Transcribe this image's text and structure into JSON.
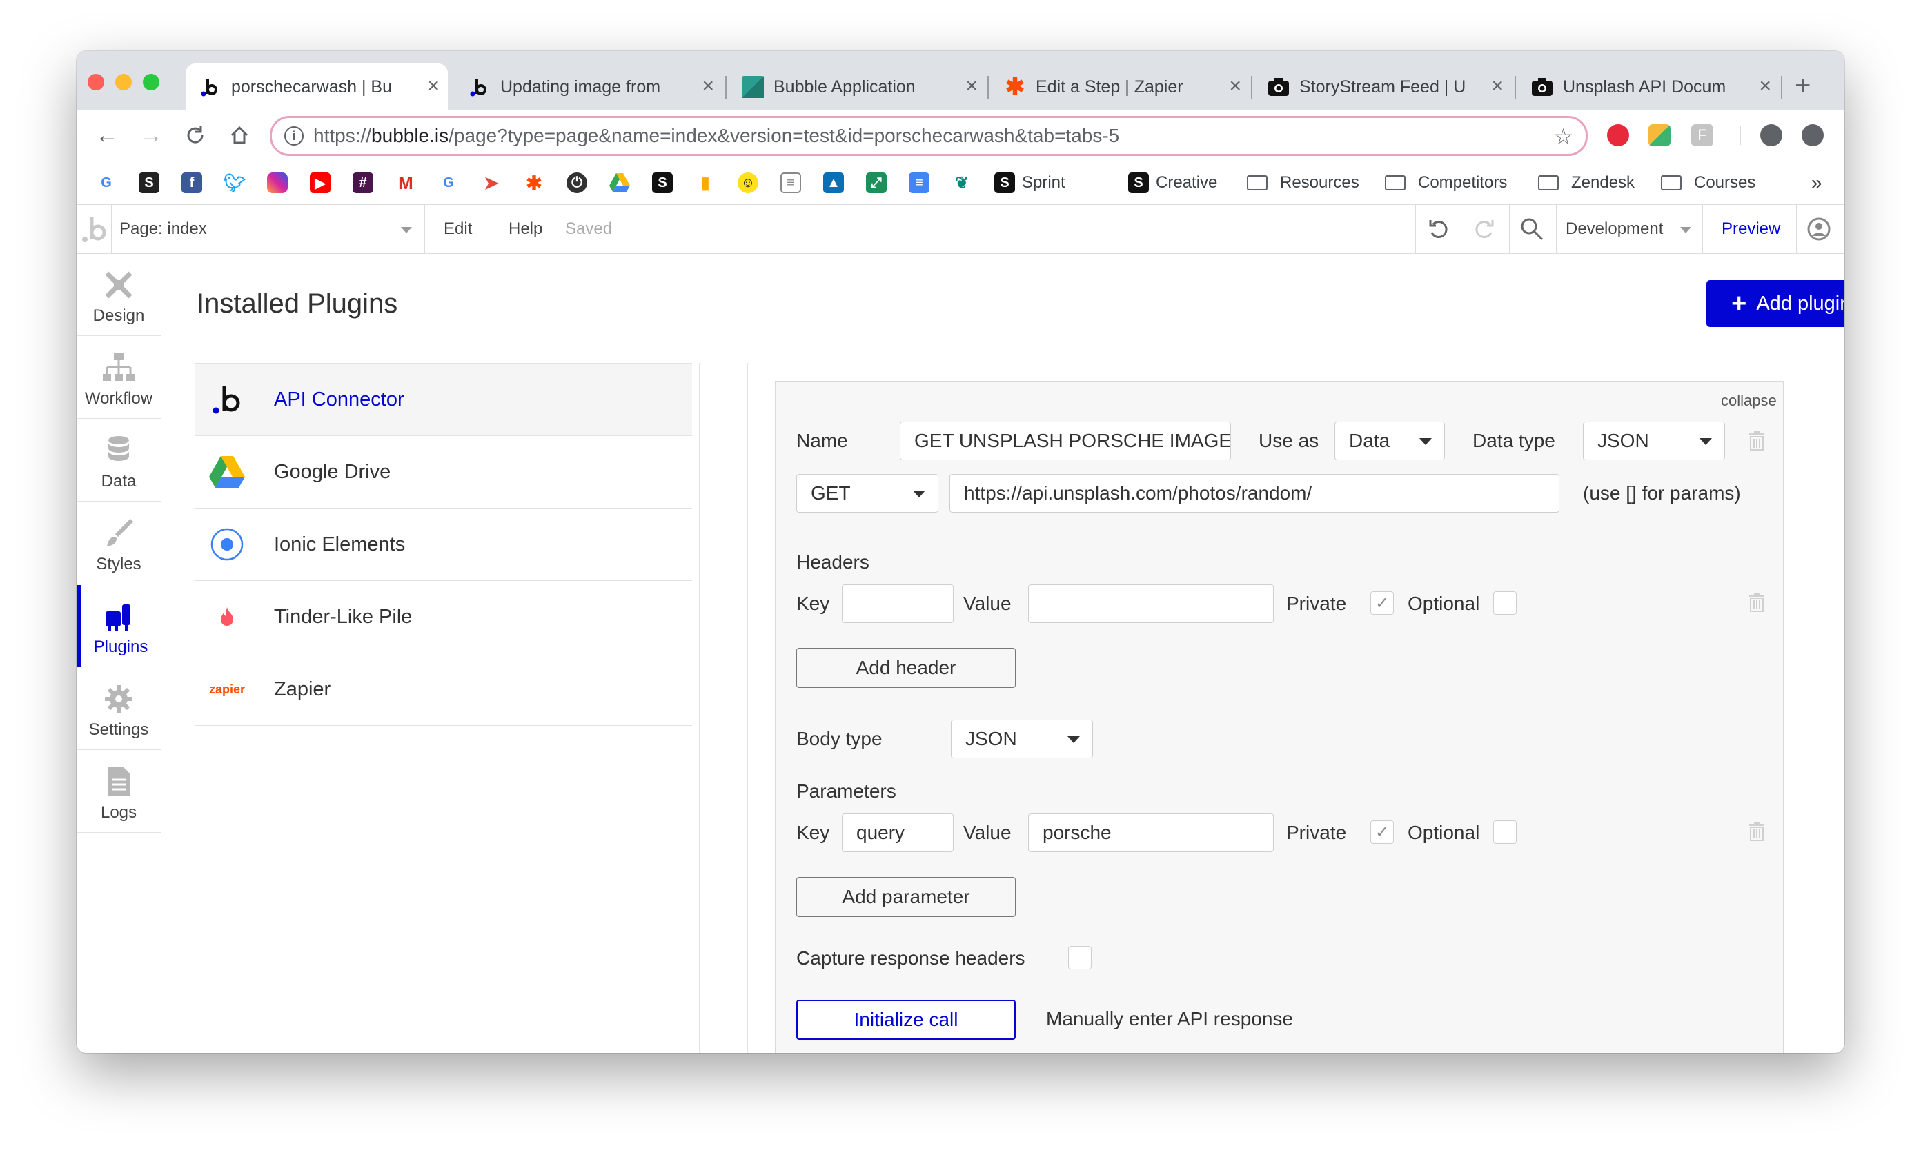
{
  "browser": {
    "tabs": [
      {
        "title": "porschecarwash | Bu",
        "icon": "bubble-icon",
        "active": true
      },
      {
        "title": "Updating image from",
        "icon": "bubble-icon",
        "active": false
      },
      {
        "title": "Bubble Application",
        "icon": "bubble-app-icon",
        "active": false
      },
      {
        "title": "Edit a Step | Zapier",
        "icon": "zapier-icon",
        "active": false
      },
      {
        "title": "StoryStream Feed | U",
        "icon": "camera-icon",
        "active": false
      },
      {
        "title": "Unsplash API Docum",
        "icon": "camera-icon",
        "active": false
      }
    ],
    "new_tab": "+",
    "url_prefix": "https://",
    "url_host": "bubble.is",
    "url_path": "/page?type=page&name=index&version=test&id=porschecarwash&tab=tabs-5",
    "bookmarks": [
      {
        "label": "Sprint",
        "icon": "s-icon"
      },
      {
        "label": "Creative",
        "icon": "s-icon"
      },
      {
        "label": "Resources",
        "icon": "folder-icon"
      },
      {
        "label": "Competitors",
        "icon": "folder-icon"
      },
      {
        "label": "Zendesk",
        "icon": "folder-icon"
      },
      {
        "label": "Courses",
        "icon": "folder-icon"
      }
    ],
    "bookmarks_more": "»"
  },
  "appbar": {
    "page_selector": "Page: index",
    "menu_edit": "Edit",
    "menu_help": "Help",
    "status": "Saved",
    "environment": "Development",
    "preview": "Preview"
  },
  "sidebar": {
    "items": [
      {
        "label": "Design",
        "icon": "design-icon"
      },
      {
        "label": "Workflow",
        "icon": "workflow-icon"
      },
      {
        "label": "Data",
        "icon": "database-icon"
      },
      {
        "label": "Styles",
        "icon": "brush-icon"
      },
      {
        "label": "Plugins",
        "icon": "plug-icon",
        "active": true
      },
      {
        "label": "Settings",
        "icon": "gear-icon"
      },
      {
        "label": "Logs",
        "icon": "document-icon"
      }
    ]
  },
  "main": {
    "title": "Installed Plugins",
    "add_plugins_label": "Add plugins",
    "plugins": [
      {
        "name": "API Connector",
        "icon": "bubble-logo-icon",
        "active": true
      },
      {
        "name": "Google Drive",
        "icon": "google-drive-icon"
      },
      {
        "name": "Ionic Elements",
        "icon": "ionic-icon"
      },
      {
        "name": "Tinder-Like Pile",
        "icon": "flame-icon"
      },
      {
        "name": "Zapier",
        "icon": "zapier-logo",
        "logo_text": "zapier"
      }
    ]
  },
  "api_call": {
    "collapse": "collapse",
    "name_label": "Name",
    "name_value": "GET UNSPLASH PORSCHE IMAGE",
    "use_as_label": "Use as",
    "use_as_value": "Data",
    "data_type_label": "Data type",
    "data_type_value": "JSON",
    "method": "GET",
    "url": "https://api.unsplash.com/photos/random/",
    "params_hint": "(use [] for params)",
    "headers_title": "Headers",
    "key_label": "Key",
    "value_label": "Value",
    "private_label": "Private",
    "optional_label": "Optional",
    "header_key": "",
    "header_value": "",
    "add_header": "Add header",
    "body_type_label": "Body type",
    "body_type_value": "JSON",
    "parameters_title": "Parameters",
    "param_key": "query",
    "param_value": "porsche",
    "add_parameter": "Add parameter",
    "capture_headers_label": "Capture response headers",
    "initialize_call": "Initialize call",
    "manual_response": "Manually enter API response",
    "checkmark": "✓"
  },
  "colors": {
    "accent": "#0205d3",
    "tab_strip": "#dee1e6",
    "omnibox_border": "#e9a3c0"
  }
}
